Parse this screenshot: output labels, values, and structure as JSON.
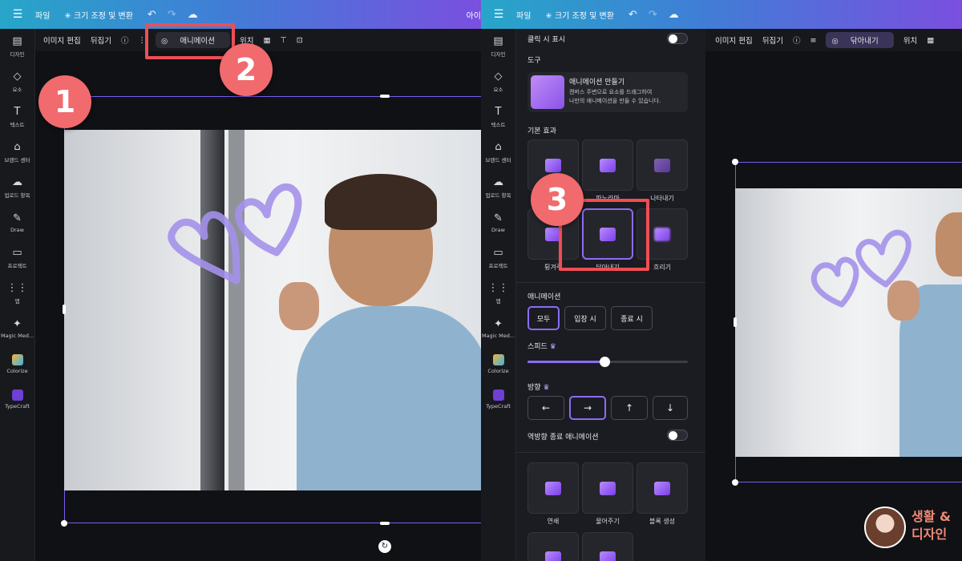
{
  "top_menu": {
    "file": "파일",
    "resize": "크기 조정 및 변환",
    "right_cut": "아이"
  },
  "left_rail": [
    {
      "icon": "design-icon",
      "label": "디자인"
    },
    {
      "icon": "elements-icon",
      "label": "요소"
    },
    {
      "icon": "text-icon",
      "label": "텍스트"
    },
    {
      "icon": "brand-icon",
      "label": "브랜드 센터"
    },
    {
      "icon": "upload-icon",
      "label": "업로드 항목"
    },
    {
      "icon": "draw-icon",
      "label": "Draw"
    },
    {
      "icon": "projects-icon",
      "label": "프로젝트"
    },
    {
      "icon": "apps-icon",
      "label": "앱"
    },
    {
      "icon": "magic-media-icon",
      "label": "Magic Med..."
    },
    {
      "icon": "colorize-icon",
      "label": "Colorize"
    },
    {
      "icon": "typecraft-icon",
      "label": "TypeCraft"
    }
  ],
  "left_toolbar": {
    "edit_image": "이미지 편집",
    "flip": "뒤집기",
    "animate": "애니메이션",
    "position_cut": "위치"
  },
  "right_toolbar": {
    "edit_image": "이미지 편집",
    "flip": "뒤집기",
    "active_effect": "닦아내기",
    "position": "위치"
  },
  "badges": {
    "one": "1",
    "two": "2",
    "three": "3"
  },
  "animation_panel": {
    "show_on_click": "클릭 시 표시",
    "tools_heading": "도구",
    "tool_title": "애니메이션 만들기",
    "tool_desc_1": "캔버스 주변으로 요소를 드래그하여",
    "tool_desc_2": "나만의 애니메이션을 만들 수 있습니다.",
    "basic_heading": "기본 효과",
    "effects": [
      {
        "label": ""
      },
      {
        "label": "파노라마"
      },
      {
        "label": "나타내기"
      },
      {
        "label": "튕겨주"
      },
      {
        "label": "닦아내기",
        "selected": true
      },
      {
        "label": "흐리기"
      }
    ],
    "animation_heading": "애니메이션",
    "scope_buttons": [
      "모두",
      "입장 시",
      "종료 시"
    ],
    "scope_selected": "모두",
    "speed_label": "스피드",
    "speed_level": 0.48,
    "direction_label": "방향",
    "directions": [
      "←",
      "→",
      "↑",
      "↓"
    ],
    "direction_selected": "→",
    "reverse_label": "역방향 종료 애니메이션",
    "more_effects": [
      {
        "label": "연쇄"
      },
      {
        "label": "물어주기"
      },
      {
        "label": "블록 생성"
      }
    ]
  },
  "brand_text": {
    "line1": "생활 &",
    "line2": "디자인"
  },
  "colors": {
    "accent": "#8b6cf5",
    "highlight": "#ee4e55",
    "badge": "#f06a6e",
    "heart": "#a491ea"
  }
}
